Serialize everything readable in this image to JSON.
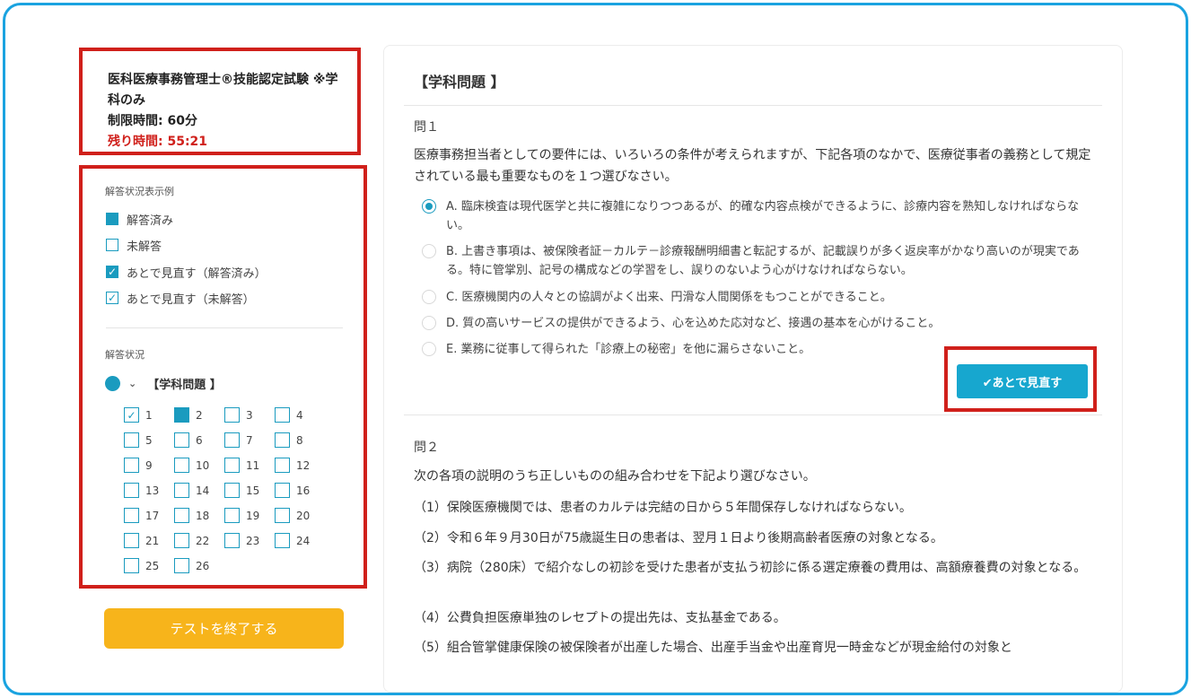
{
  "exam": {
    "title": "医科医療事務管理士®技能認定試験 ※学科のみ",
    "time_limit": "制限時間: 60分",
    "remaining": "残り時間: 55:21"
  },
  "legend": {
    "caption": "解答状況表示例",
    "answered": "解答済み",
    "unanswered": "未解答",
    "review_answered": "あとで見直す（解答済み）",
    "review_unanswered": "あとで見直す（未解答）"
  },
  "status": {
    "caption": "解答状況",
    "section_title": "【学科問題 】",
    "questions": [
      {
        "n": "1",
        "state": "review"
      },
      {
        "n": "2",
        "state": "answered"
      },
      {
        "n": "3",
        "state": "empty"
      },
      {
        "n": "4",
        "state": "empty"
      },
      {
        "n": "5",
        "state": "empty"
      },
      {
        "n": "6",
        "state": "empty"
      },
      {
        "n": "7",
        "state": "empty"
      },
      {
        "n": "8",
        "state": "empty"
      },
      {
        "n": "9",
        "state": "empty"
      },
      {
        "n": "10",
        "state": "empty"
      },
      {
        "n": "11",
        "state": "empty"
      },
      {
        "n": "12",
        "state": "empty"
      },
      {
        "n": "13",
        "state": "empty"
      },
      {
        "n": "14",
        "state": "empty"
      },
      {
        "n": "15",
        "state": "empty"
      },
      {
        "n": "16",
        "state": "empty"
      },
      {
        "n": "17",
        "state": "empty"
      },
      {
        "n": "18",
        "state": "empty"
      },
      {
        "n": "19",
        "state": "empty"
      },
      {
        "n": "20",
        "state": "empty"
      },
      {
        "n": "21",
        "state": "empty"
      },
      {
        "n": "22",
        "state": "empty"
      },
      {
        "n": "23",
        "state": "empty"
      },
      {
        "n": "24",
        "state": "empty"
      },
      {
        "n": "25",
        "state": "empty"
      },
      {
        "n": "26",
        "state": "empty"
      }
    ]
  },
  "end_button": "テストを終了する",
  "main": {
    "title": "【学科問題 】",
    "q1": {
      "label": "問１",
      "text": "医療事務担当者としての要件には、いろいろの条件が考えられますが、下記各項のなかで、医療従事者の義務として規定されている最も重要なものを１つ選びなさい。",
      "options": [
        "A. 臨床検査は現代医学と共に複雑になりつつあるが、的確な内容点検ができるように、診療内容を熟知しなければならない。",
        "B. 上書き事項は、被保険者証－カルテ－診療報酬明細書と転記するが、記載誤りが多く返戻率がかなり高いのが現実である。特に管掌別、記号の構成などの学習をし、誤りのないよう心がけなければならない。",
        "C. 医療機関内の人々との協調がよく出来、円滑な人間関係をもつことができること。",
        "D. 質の高いサービスの提供ができるよう、心を込めた応対など、接遇の基本を心がけること。",
        "E. 業務に従事して得られた「診療上の秘密」を他に漏らさないこと。"
      ],
      "selected": "A",
      "review_button": "✔あとで見直す"
    },
    "q2": {
      "label": "問２",
      "text": "次の各項の説明のうち正しいものの組み合わせを下記より選びなさい。",
      "statements": [
        "（1）保険医療機関では、患者のカルテは完結の日から５年間保存しなければならない。",
        "（2）令和６年９月30日が75歳誕生日の患者は、翌月１日より後期高齢者医療の対象となる。",
        "（3）病院（280床）で紹介なしの初診を受けた患者が支払う初診に係る選定療養の費用は、高額療養費の対象となる。",
        "（4）公費負担医療単独のレセプトの提出先は、支払基金である。",
        "（5）組合管掌健康保険の被保険者が出産した場合、出産手当金や出産育児一時金などが現金給付の対象と"
      ]
    }
  },
  "colors": {
    "accent": "#1a9bbf",
    "button": "#17a7cf",
    "end_button": "#f7b41b",
    "highlight": "#d0201b",
    "frame": "#1aa3e0"
  }
}
